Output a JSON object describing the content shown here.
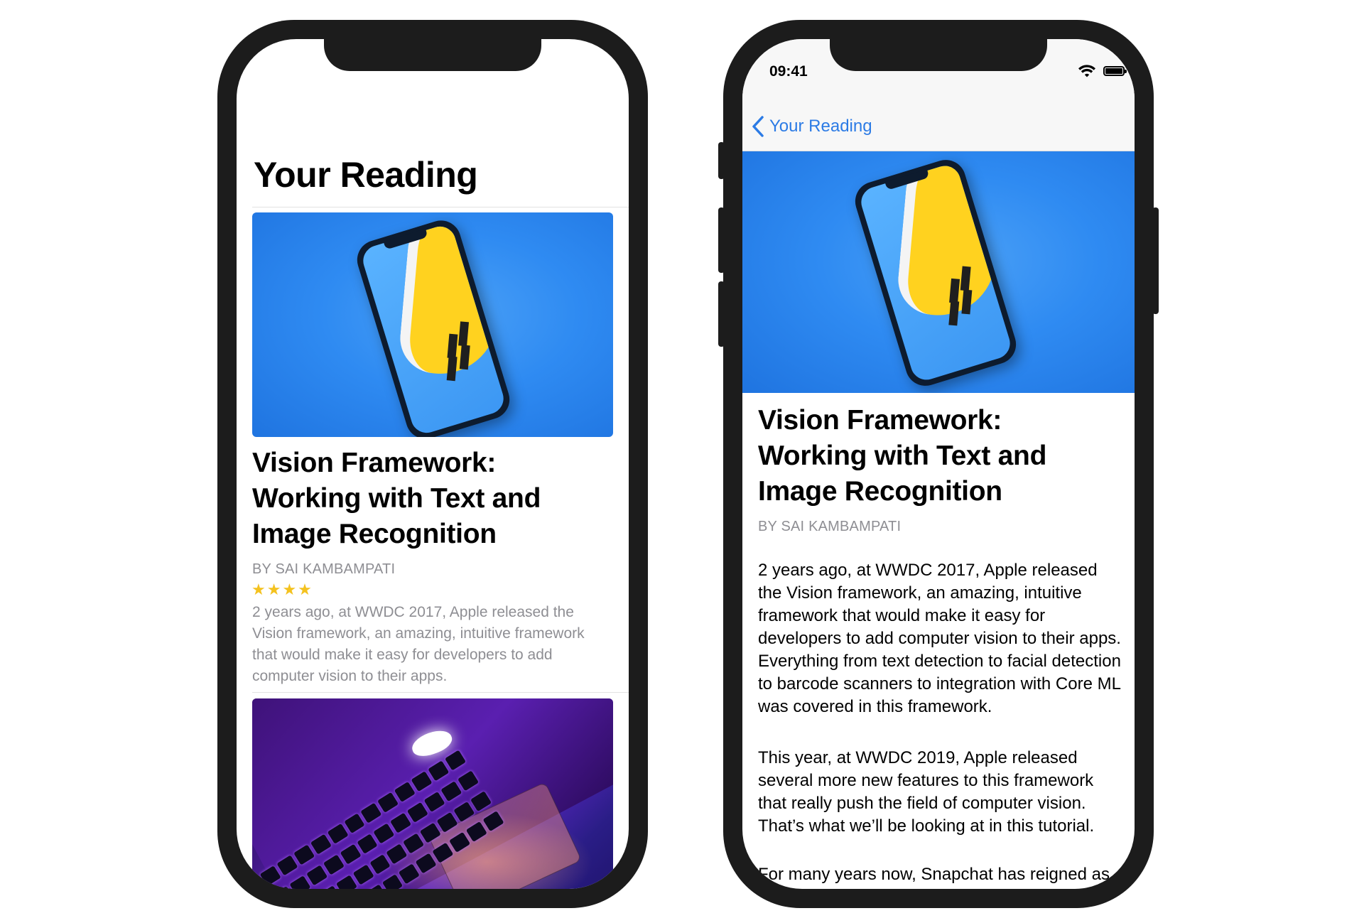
{
  "list_screen": {
    "title": "Your Reading",
    "articles": [
      {
        "title": "Vision Framework: Working with Text and Image Recognition",
        "author": "BY SAI KAMBAMPATI",
        "rating": 4,
        "stars": "★★★★",
        "summary": "2 years ago, at WWDC 2017, Apple released the Vision framework, an amazing, intuitive framework that would make it easy for developers to add computer vision to their apps."
      }
    ]
  },
  "detail_screen": {
    "status_time": "09:41",
    "back_label": "Your Reading",
    "title": "Vision Framework: Working with Text and Image Recognition",
    "author": "BY SAI KAMBAMPATI",
    "paragraphs": [
      "2 years ago, at WWDC 2017, Apple released the Vision framework, an amazing, intuitive framework that would make it easy for developers to add computer vision to their apps. Everything from text detection to facial detection to barcode scanners to integration with Core ML was covered in this framework.",
      "This year, at WWDC 2019, Apple released several more new features to this framework that really push the field of computer vision. That’s what we’ll be looking at in this tutorial.",
      "For many years now, Snapchat has reigned as the popular social media app among"
    ]
  },
  "colors": {
    "accent": "#2c7be5",
    "secondary_text": "#8e8e93",
    "star": "#f4c21f",
    "frame": "#1c1c1c",
    "photo_blue": "#2f8bf2"
  },
  "icons": [
    "chevron-left-icon",
    "wifi-icon",
    "battery-icon",
    "star-icon"
  ]
}
